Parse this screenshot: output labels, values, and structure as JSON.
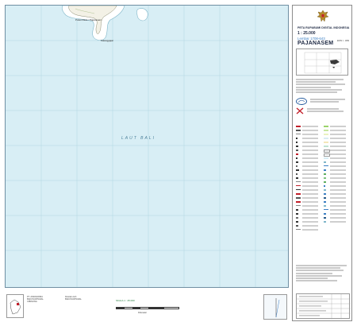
{
  "map": {
    "sea_label": "LAUT BALI",
    "island_label": "Pulau Raas / Pajanasem",
    "island_label_2": "Kalanggajar",
    "colors": {
      "sea": "#d8eef5",
      "land": "#f3f1e6",
      "reef": "#ffffff",
      "grid": "#a9cfdd",
      "frame": "#6f8fa3"
    }
  },
  "title_block": {
    "series": "PETA RUPABUMI DIGITAL INDONESIA",
    "scale": "1 : 25.000",
    "sheet_number": "Lembar 1708-643",
    "sheet_name": "PAJANASEM",
    "edition": "EDISI I - 1999"
  },
  "bottom": {
    "scale_caption": "SKALA 1 : 25.000",
    "scale_sub": "Kilometer",
    "left_note": "PT. ANDASWIDA\nBAKOSURTANAL\nCIBINONG",
    "mid_note": "Dicetak oleh\nBAKOSURTANAL"
  },
  "icons": [
    "garuda-emblem-icon",
    "logo-bakosurtanal-icon",
    "logo-partner-icon"
  ]
}
